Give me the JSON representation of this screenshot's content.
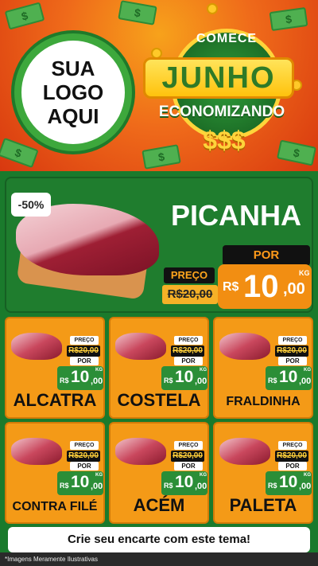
{
  "header": {
    "logo": [
      "SUA",
      "LOGO",
      "AQUI"
    ],
    "promo": {
      "line1": "COMECE",
      "line2": "JUNHO",
      "line3": "ECONOMIZANDO",
      "line4": "$$$"
    }
  },
  "featured": {
    "discount": "-50%",
    "name": "PICANHA",
    "preco_label": "PREÇO",
    "old_price": "R$20,00",
    "por_label": "POR",
    "currency": "R$",
    "price_int": "10",
    "price_dec": ",00",
    "unit": "KG"
  },
  "products": [
    {
      "name": "ALCATRA",
      "preco_label": "PREÇO",
      "old_price": "R$20,00",
      "por_label": "POR",
      "currency": "R$",
      "price_int": "10",
      "price_dec": ",00",
      "unit": "KG"
    },
    {
      "name": "COSTELA",
      "preco_label": "PREÇO",
      "old_price": "R$20,00",
      "por_label": "POR",
      "currency": "R$",
      "price_int": "10",
      "price_dec": ",00",
      "unit": "KG"
    },
    {
      "name": "FRALDINHA",
      "preco_label": "PREÇO",
      "old_price": "R$20,00",
      "por_label": "POR",
      "currency": "R$",
      "price_int": "10",
      "price_dec": ",00",
      "unit": "KG"
    },
    {
      "name": "CONTRA FILÉ",
      "preco_label": "PREÇO",
      "old_price": "R$20,00",
      "por_label": "POR",
      "currency": "R$",
      "price_int": "10",
      "price_dec": ",00",
      "unit": "KG"
    },
    {
      "name": "ACÉM",
      "preco_label": "PREÇO",
      "old_price": "R$20,00",
      "por_label": "POR",
      "currency": "R$",
      "price_int": "10",
      "price_dec": ",00",
      "unit": "KG"
    },
    {
      "name": "PALETA",
      "preco_label": "PREÇO",
      "old_price": "R$20,00",
      "por_label": "POR",
      "currency": "R$",
      "price_int": "10",
      "price_dec": ",00",
      "unit": "KG"
    }
  ],
  "cta": "Crie seu encarte com este tema!",
  "footnote": "*Imagens Meramente Ilustrativas",
  "colors": {
    "header_orange": "#ef6a1a",
    "green": "#1f7d2e",
    "card_orange": "#f49a17",
    "price_green": "#2b8e37"
  }
}
